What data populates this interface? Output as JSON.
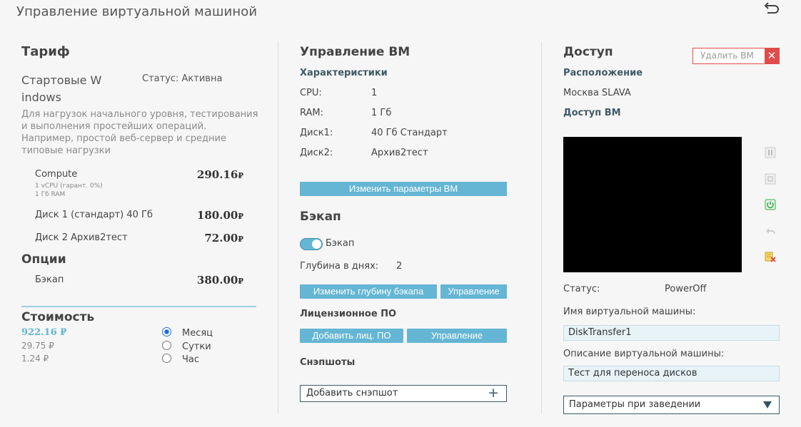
{
  "header": {
    "title": "Управление виртуальной машиной"
  },
  "tariff": {
    "heading": "Тариф",
    "plan_name_line1": "Стартовые W",
    "plan_name_line2": "indows",
    "status": "Статус: Активна",
    "description": "Для нагрузок начального уровня, тестирования и выполнения простейших операций. Например, простой веб-сервер и средние типовые нагрузки",
    "items": [
      {
        "label": "Compute",
        "sub1": "1 vCPU (гарант. 0%)",
        "sub2": "1 Гб RAM",
        "price": "290.16",
        "currency": "₽"
      },
      {
        "label": "Диск 1 (стандарт) 40 Гб",
        "price": "180.00",
        "currency": "₽"
      },
      {
        "label": "Диск 2 Архив2тест",
        "price": "72.00",
        "currency": "₽"
      }
    ],
    "options_heading": "Опции",
    "options": [
      {
        "label": "Бэкап",
        "price": "380.00",
        "currency": "₽"
      }
    ],
    "cost_heading": "Стоимость",
    "cost_month": "922.16 ₽",
    "cost_day": "29.75 ₽",
    "cost_hour": "1.24 ₽",
    "periods": [
      {
        "label": "Месяц",
        "checked": true
      },
      {
        "label": "Сутки",
        "checked": false
      },
      {
        "label": "Час",
        "checked": false
      }
    ]
  },
  "vm": {
    "heading": "Управление ВМ",
    "specs_heading": "Характеристики",
    "specs": [
      {
        "key": "CPU:",
        "value": "1"
      },
      {
        "key": "RAM:",
        "value": "1 Гб"
      },
      {
        "key": "Диск1:",
        "value": "40 Гб Стандарт"
      },
      {
        "key": "Диск2:",
        "value": "Архив2тест"
      }
    ],
    "change_params_button": "Изменить параметры ВМ",
    "backup_heading": "Бэкап",
    "backup_toggle_label": "Бэкап",
    "backup_enabled": true,
    "depth_label": "Глубина в днях:",
    "depth_value": "2",
    "change_depth_button": "Изменить глубину бэкапа",
    "backup_manage_button": "Управление",
    "license_heading": "Лицензионное ПО",
    "add_license_button": "Добавить лиц. ПО",
    "license_manage_button": "Управление",
    "snapshots_heading": "Снэпшоты",
    "add_snapshot_button": "Добавить снэпшот"
  },
  "access": {
    "heading": "Доступ",
    "delete_button": "Удалить ВМ",
    "location_heading": "Расположение",
    "location_value": "Москва SLAVA",
    "vm_access_heading": "Доступ ВМ",
    "status_label": "Статус:",
    "status_value": "PowerOff",
    "vm_name_label": "Имя виртуальной машины:",
    "vm_name_value": "DiskTransfer1",
    "vm_desc_label": "Описание виртуальной машины:",
    "vm_desc_value": "Тест для переноса дисков",
    "params_dropdown": "Параметры при заведении",
    "colors": {
      "accent": "#64b6d4",
      "danger": "#e04b4b",
      "power": "#3aa84a",
      "console": "#000000"
    },
    "side_icons": [
      "pause-icon",
      "stop-icon",
      "power-icon",
      "undo-icon",
      "delete-snapshot-icon"
    ]
  }
}
